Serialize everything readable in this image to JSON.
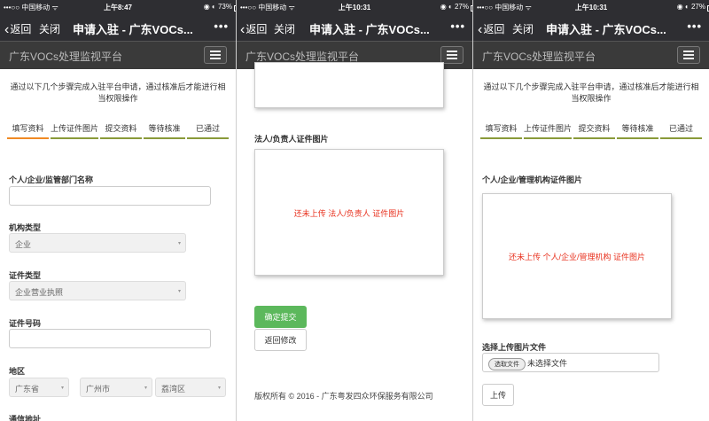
{
  "screens": [
    {
      "status": {
        "carrier": "•••○○ 中国移动 ᯤ",
        "time": "上午8:47",
        "right": "◉ ◐ 73%"
      },
      "nav": {
        "back": "返回",
        "close": "关闭",
        "title": "申请入驻 - 广东VOCs...",
        "more": "•••"
      },
      "app": {
        "brand": "广东VOCs处理监视平台"
      },
      "intro": "通过以下几个步骤完成入驻平台申请，通过核准后才能进行相当权限操作",
      "steps": [
        "填写资料",
        "上传证件图片",
        "提交资料",
        "等待核准",
        "已通过"
      ],
      "form": {
        "org_name_label": "个人/企业/监管部门名称",
        "org_type_label": "机构类型",
        "org_type_value": "企业",
        "cert_type_label": "证件类型",
        "cert_type_value": "企业营业执照",
        "cert_no_label": "证件号码",
        "region_label": "地区",
        "province": "广东省",
        "city": "广州市",
        "district": "荔湾区",
        "address_label": "通信地址"
      }
    },
    {
      "status": {
        "carrier": "•••○○ 中国移动 ᯤ",
        "time": "上午10:31",
        "right": "◉ ◐ 27%"
      },
      "nav": {
        "back": "返回",
        "close": "关闭",
        "title": "申请入驻 - 广东VOCs...",
        "more": "•••"
      },
      "app": {
        "brand": "广东VOCs处理监视平台"
      },
      "legal_label": "法人/负责人证件图片",
      "legal_msg": "还未上传 法人/负责人 证件图片",
      "confirm_btn": "确定提交",
      "back_btn": "返回修改",
      "footer": "版权所有 © 2016 - 广东粤发四众环保服务有限公司"
    },
    {
      "status": {
        "carrier": "•••○○ 中国移动 ᯤ",
        "time": "上午10:31",
        "right": "◉ ◐ 27%"
      },
      "nav": {
        "back": "返回",
        "close": "关闭",
        "title": "申请入驻 - 广东VOCs...",
        "more": "•••"
      },
      "app": {
        "brand": "广东VOCs处理监视平台"
      },
      "intro": "通过以下几个步骤完成入驻平台申请，通过核准后才能进行相当权限操作",
      "steps": [
        "填写资料",
        "上传证件图片",
        "提交资料",
        "等待核准",
        "已通过"
      ],
      "cert_label": "个人/企业/管理机构证件图片",
      "cert_msg": "还未上传 个人/企业/管理机构 证件图片",
      "file_label": "选择上传图片文件",
      "choose_btn": "选取文件",
      "no_file": "未选择文件",
      "upload_btn": "上传"
    }
  ],
  "colors": {
    "bar": "#2e2e32",
    "active_step": "#f08a24",
    "step": "#8a9a3a",
    "alert": "#e8321f",
    "confirm": "#5cb85c"
  }
}
